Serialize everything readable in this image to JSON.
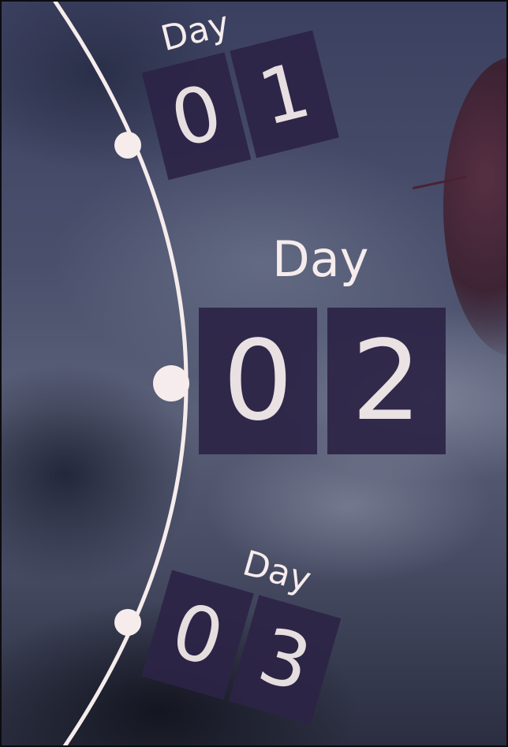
{
  "timeline": {
    "days": [
      {
        "label": "Day",
        "digit_tens": "0",
        "digit_ones": "1",
        "selected": false
      },
      {
        "label": "Day",
        "digit_tens": "0",
        "digit_ones": "2",
        "selected": true
      },
      {
        "label": "Day",
        "digit_tens": "0",
        "digit_ones": "3",
        "selected": false
      }
    ],
    "colors": {
      "tile": "#2d2446",
      "text": "#f6ecec",
      "arc": "#f6ecec"
    }
  }
}
